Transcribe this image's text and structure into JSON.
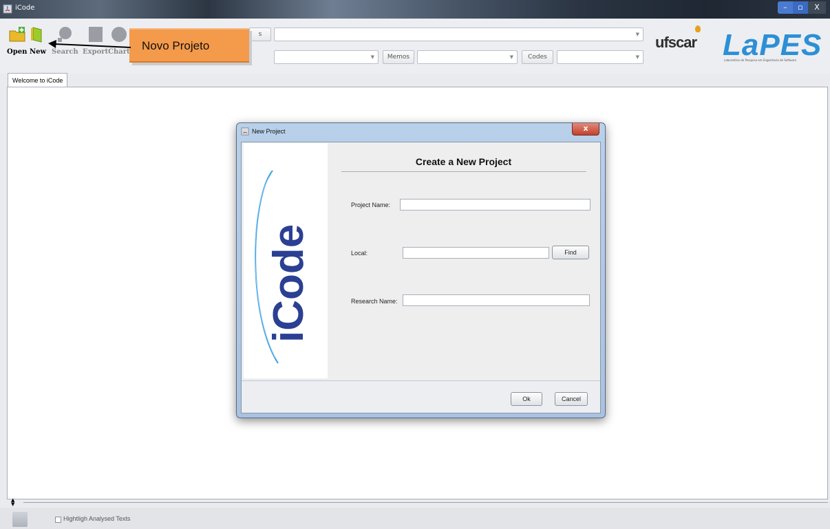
{
  "window": {
    "title": "iCode",
    "min": "–",
    "max": "▫",
    "close": "X"
  },
  "toolbar": {
    "open": "Open",
    "new": "New",
    "search": "Search",
    "export": "Export",
    "chart": "Chart",
    "memos_label": "Memos",
    "codes_label": "Codes",
    "partial_label": "s"
  },
  "callout": {
    "text": "Novo Projeto"
  },
  "logos": {
    "ufscar": "ufscar",
    "lapes": "LaPES",
    "lapes_sub": "Laboratório de Pesquisa em Engenharia de Software"
  },
  "tabs": [
    {
      "label": "Welcome to iCode"
    }
  ],
  "bottom": {
    "highlight_label": "Hightligh Analysed Texts"
  },
  "dialog": {
    "title": "New Project",
    "close": "x",
    "heading": "Create a New Project",
    "logo_text": "iCode",
    "fields": {
      "project_name_label": "Project Name:",
      "project_name_value": "",
      "local_label": "Local:",
      "local_value": "",
      "research_name_label": "Research Name:",
      "research_name_value": ""
    },
    "find_button": "Find",
    "ok_button": "Ok",
    "cancel_button": "Cancel"
  },
  "colors": {
    "callout": "#f39a4b",
    "lapes_blue": "#2d8fd6",
    "icode_blue": "#2b3f93"
  }
}
